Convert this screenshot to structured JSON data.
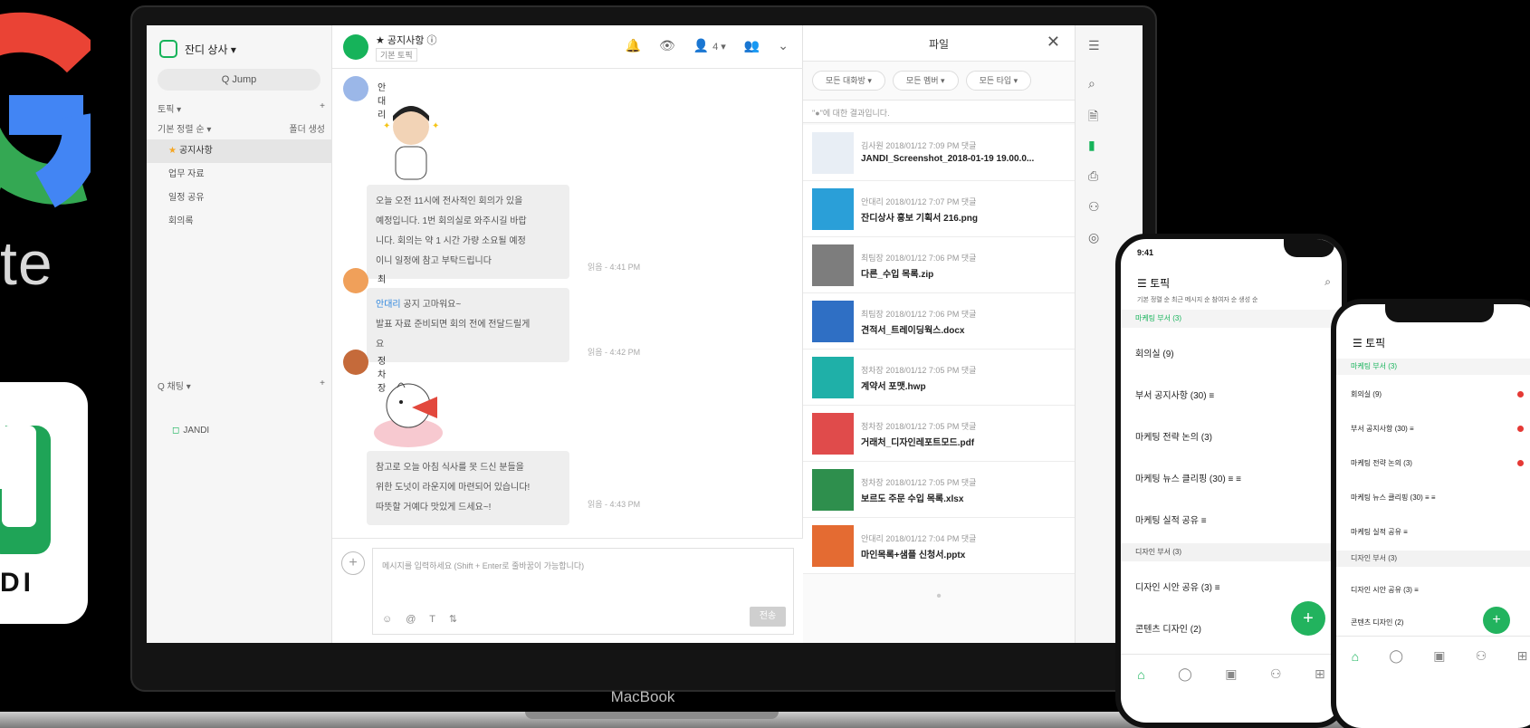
{
  "brand": {
    "suite_text": "te",
    "jandi_text": "DI"
  },
  "laptop": {
    "label": "MacBook"
  },
  "app": {
    "team_name": "잔디 상사 ▾",
    "jump_label": "Q Jump",
    "topics_section": "토픽 ▾",
    "sort_label": "기본 정렬 순 ▾",
    "sort_action": "폴더 생성",
    "topics": [
      {
        "label": "공지사항",
        "starred": true
      },
      {
        "label": "업무 자료",
        "starred": false
      },
      {
        "label": "일정 공유",
        "starred": false
      },
      {
        "label": "회의록",
        "starred": false
      }
    ],
    "dm_section": "Q 채팅 ▾",
    "dm_item": "JANDI",
    "accent": "#16b35a"
  },
  "chat": {
    "room_title": "★ 공지사항 ⓘ",
    "room_sub": "기본 토픽",
    "members": "4 ▾",
    "messages": [
      {
        "user": "안대리",
        "text_lines": [
          "오늘 오전 11시에 전사적인 회의가 있을",
          "예정입니다. 1번 회의실로 와주시길 바랍",
          "니다. 회의는 약 1 시간 가량 소요될 예정",
          "이니 일정에 참고 부탁드립니다"
        ],
        "time": "읽음 - 4:41 PM"
      },
      {
        "user": "최팀장",
        "mention": "안대리",
        "text_lines": [
          "공지 고마워요~",
          "발표 자료 준비되면 회의 전에 전달드릴게",
          "요"
        ],
        "time": "읽음 - 4:42 PM"
      },
      {
        "user": "정차장",
        "text_lines": [
          "참고로 오늘 아침 식사를 못 드신 분들을",
          "위한 도넛이 라운지에 마련되어 있습니다!",
          "따뜻할 거예다 맛있게 드세요~!"
        ],
        "time": "읽음 - 4:43 PM"
      }
    ],
    "input_placeholder": "메시지를 입력하세요 (Shift + Enter로 줄바꿈이 가능합니다)",
    "tools": "☺ @ T ⇅",
    "send_label": "전송"
  },
  "files": {
    "title": "파일",
    "filters": [
      "모든 대화방 ▾",
      "모든 멤버 ▾",
      "모든 타입 ▾"
    ],
    "search_placeholder": "\"●\"에 대한 결과입니다.",
    "items": [
      {
        "meta": "김사원 2018/01/12 7:09 PM 댓글",
        "name": "JANDI_Screenshot_2018-01-19 19.00.0...",
        "color": "#e8eef5"
      },
      {
        "meta": "안대리 2018/01/12 7:07 PM 댓글",
        "name": "잔디상사 홍보 기획서 216.png",
        "color": "#2a9fd8"
      },
      {
        "meta": "최팀장 2018/01/12 7:06 PM 댓글",
        "name": "다른_수입 목록.zip",
        "color": "#7d7d7d"
      },
      {
        "meta": "최팀장 2018/01/12 7:06 PM 댓글",
        "name": "견적서_트레이딩웍스.docx",
        "color": "#2f6fc4"
      },
      {
        "meta": "정차장 2018/01/12 7:05 PM 댓글",
        "name": "계약서 포맷.hwp",
        "color": "#1fb0a8"
      },
      {
        "meta": "정차장 2018/01/12 7:05 PM 댓글",
        "name": "거래처_디자인레포트모드.pdf",
        "color": "#e04b4b"
      },
      {
        "meta": "정차장 2018/01/12 7:05 PM 댓글",
        "name": "보르도 주문 수입 목록.xlsx",
        "color": "#2e8f4d"
      },
      {
        "meta": "안대리 2018/01/12 7:04 PM 댓글",
        "name": "마인목록+샘플 신청서.pptx",
        "color": "#e46b32"
      }
    ]
  },
  "phone1": {
    "status_time": "9:41",
    "title": "☰ 토픽",
    "sort": "기본 정렬 순   최근 메시지 순   참여자 순   생성 순",
    "section": "마케팅 부서 (3)",
    "items": [
      "회의실 (9)",
      "부서 공지사항 (30) ≡",
      "마케팅 전략 논의 (3)",
      "마케팅 뉴스 클리핑 (30) ≡ ≡",
      "마케팅 실적 공유 ≡"
    ],
    "group": "디자인 부서 (3)",
    "items2": [
      "디자인 시안 공유 (3) ≡",
      "콘텐츠 디자인 (2)"
    ]
  },
  "phone2": {
    "title": "☰ 토픽",
    "section": "마케팅 부서 (3)",
    "items": [
      "회의실 (9)",
      "부서 공지사항 (30) ≡",
      "마케팅 전략 논의 (3)",
      "마케팅 뉴스 클리핑 (30) ≡ ≡",
      "마케팅 실적 공유 ≡"
    ],
    "group": "디자인 부서 (3)",
    "items2": [
      "디자인 시안 공유 (3) ≡",
      "콘텐츠 디자인 (2)"
    ]
  }
}
